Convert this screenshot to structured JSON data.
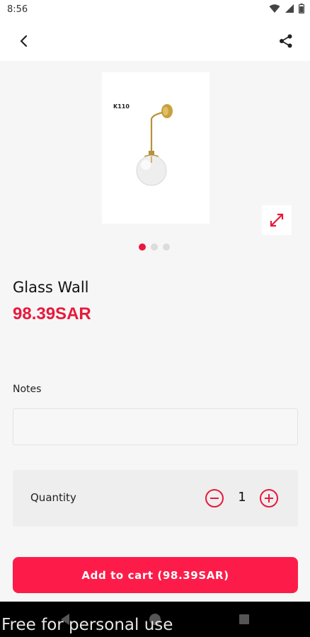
{
  "status_bar": {
    "time": "8:56"
  },
  "product": {
    "image_code": "K110",
    "title": "Glass Wall",
    "price": "98.39SAR",
    "carousel": {
      "total": 3,
      "active": 1
    }
  },
  "notes": {
    "label": "Notes",
    "value": "",
    "placeholder": ""
  },
  "quantity": {
    "label": "Quantity",
    "value": "1"
  },
  "cart_button": {
    "label": "Add to cart (98.39SAR)"
  },
  "watermark": "Free for personal use",
  "colors": {
    "accent": "#e8193c",
    "button": "#fd1c49"
  },
  "icons": [
    "wifi-icon",
    "signal-icon",
    "battery-icon",
    "back-arrow-icon",
    "share-icon",
    "expand-icon",
    "minus-circle-icon",
    "plus-circle-icon",
    "nav-back-icon",
    "nav-home-icon",
    "nav-recents-icon"
  ]
}
